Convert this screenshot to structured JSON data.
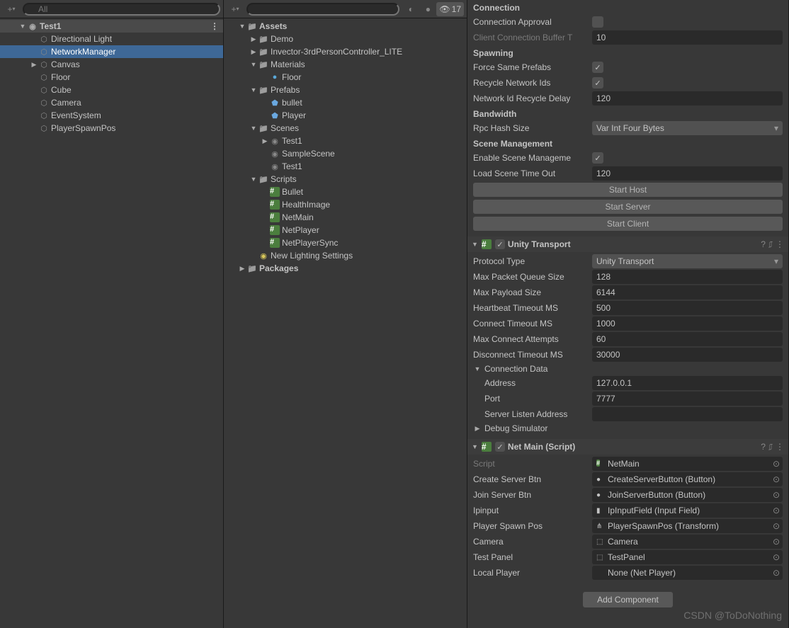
{
  "hierarchy": {
    "search_placeholder": "All",
    "root": "Test1",
    "items": [
      "Directional Light",
      "NetworkManager",
      "Canvas",
      "Floor",
      "Cube",
      "Camera",
      "EventSystem",
      "PlayerSpawnPos"
    ],
    "selected_index": 1
  },
  "project": {
    "search_placeholder": "",
    "hidden_count": "17",
    "root": "Assets",
    "tree": [
      {
        "label": "Demo",
        "icon": "folder",
        "depth": 1,
        "expand": "closed"
      },
      {
        "label": "Invector-3rdPersonController_LITE",
        "icon": "folder",
        "depth": 1,
        "expand": "closed"
      },
      {
        "label": "Materials",
        "icon": "folder",
        "depth": 1,
        "expand": "open"
      },
      {
        "label": "Floor",
        "icon": "mat",
        "depth": 2,
        "expand": ""
      },
      {
        "label": "Prefabs",
        "icon": "folder",
        "depth": 1,
        "expand": "open"
      },
      {
        "label": "bullet",
        "icon": "prefab",
        "depth": 2,
        "expand": ""
      },
      {
        "label": "Player",
        "icon": "prefab",
        "depth": 2,
        "expand": ""
      },
      {
        "label": "Scenes",
        "icon": "folder",
        "depth": 1,
        "expand": "open"
      },
      {
        "label": "Test1",
        "icon": "scene",
        "depth": 2,
        "expand": "closed"
      },
      {
        "label": "SampleScene",
        "icon": "scene",
        "depth": 2,
        "expand": ""
      },
      {
        "label": "Test1",
        "icon": "scene",
        "depth": 2,
        "expand": ""
      },
      {
        "label": "Scripts",
        "icon": "folder",
        "depth": 1,
        "expand": "open"
      },
      {
        "label": "Bullet",
        "icon": "cs",
        "depth": 2,
        "expand": ""
      },
      {
        "label": "HealthImage",
        "icon": "cs",
        "depth": 2,
        "expand": ""
      },
      {
        "label": "NetMain",
        "icon": "cs",
        "depth": 2,
        "expand": ""
      },
      {
        "label": "NetPlayer",
        "icon": "cs",
        "depth": 2,
        "expand": ""
      },
      {
        "label": "NetPlayerSync",
        "icon": "cs",
        "depth": 2,
        "expand": ""
      },
      {
        "label": "New Lighting Settings",
        "icon": "light",
        "depth": 1,
        "expand": ""
      }
    ],
    "packages": "Packages"
  },
  "inspector": {
    "connection": {
      "title": "Connection",
      "approval": "Connection Approval",
      "buffer_label": "Client Connection Buffer T",
      "buffer_value": "10"
    },
    "spawning": {
      "title": "Spawning",
      "force": "Force Same Prefabs",
      "recycle": "Recycle Network Ids",
      "delay_label": "Network Id Recycle Delay",
      "delay_value": "120"
    },
    "bandwidth": {
      "title": "Bandwidth",
      "rpc_label": "Rpc Hash Size",
      "rpc_value": "Var Int Four Bytes"
    },
    "scene": {
      "title": "Scene Management",
      "enable": "Enable Scene Manageme",
      "timeout_label": "Load Scene Time Out",
      "timeout_value": "120"
    },
    "buttons": {
      "host": "Start Host",
      "server": "Start Server",
      "client": "Start Client"
    },
    "transport": {
      "title": "Unity Transport",
      "protocol_label": "Protocol Type",
      "protocol_value": "Unity Transport",
      "queue_label": "Max Packet Queue Size",
      "queue_value": "128",
      "payload_label": "Max Payload Size",
      "payload_value": "6144",
      "heartbeat_label": "Heartbeat Timeout MS",
      "heartbeat_value": "500",
      "connect_label": "Connect Timeout MS",
      "connect_value": "1000",
      "attempts_label": "Max Connect Attempts",
      "attempts_value": "60",
      "disconnect_label": "Disconnect Timeout MS",
      "disconnect_value": "30000",
      "conn_data": "Connection Data",
      "address_label": "Address",
      "address_value": "127.0.0.1",
      "port_label": "Port",
      "port_value": "7777",
      "listen_label": "Server Listen Address",
      "listen_value": "",
      "debug": "Debug Simulator"
    },
    "netmain": {
      "title": "Net Main (Script)",
      "script_label": "Script",
      "script_value": "NetMain",
      "fields": [
        {
          "label": "Create Server Btn",
          "value": "CreateServerButton (Button)",
          "icon": "●"
        },
        {
          "label": "Join Server Btn",
          "value": "JoinServerButton (Button)",
          "icon": "●"
        },
        {
          "label": "Ipinput",
          "value": "IpInputField (Input Field)",
          "icon": "▮"
        },
        {
          "label": "Player Spawn Pos",
          "value": "PlayerSpawnPos (Transform)",
          "icon": "⋔"
        },
        {
          "label": "Camera",
          "value": "Camera",
          "icon": "⬚"
        },
        {
          "label": "Test Panel",
          "value": "TestPanel",
          "icon": "⬚"
        },
        {
          "label": "Local Player",
          "value": "None (Net Player)",
          "icon": ""
        }
      ]
    },
    "add_component": "Add Component"
  },
  "watermark": "CSDN @ToDoNothing"
}
